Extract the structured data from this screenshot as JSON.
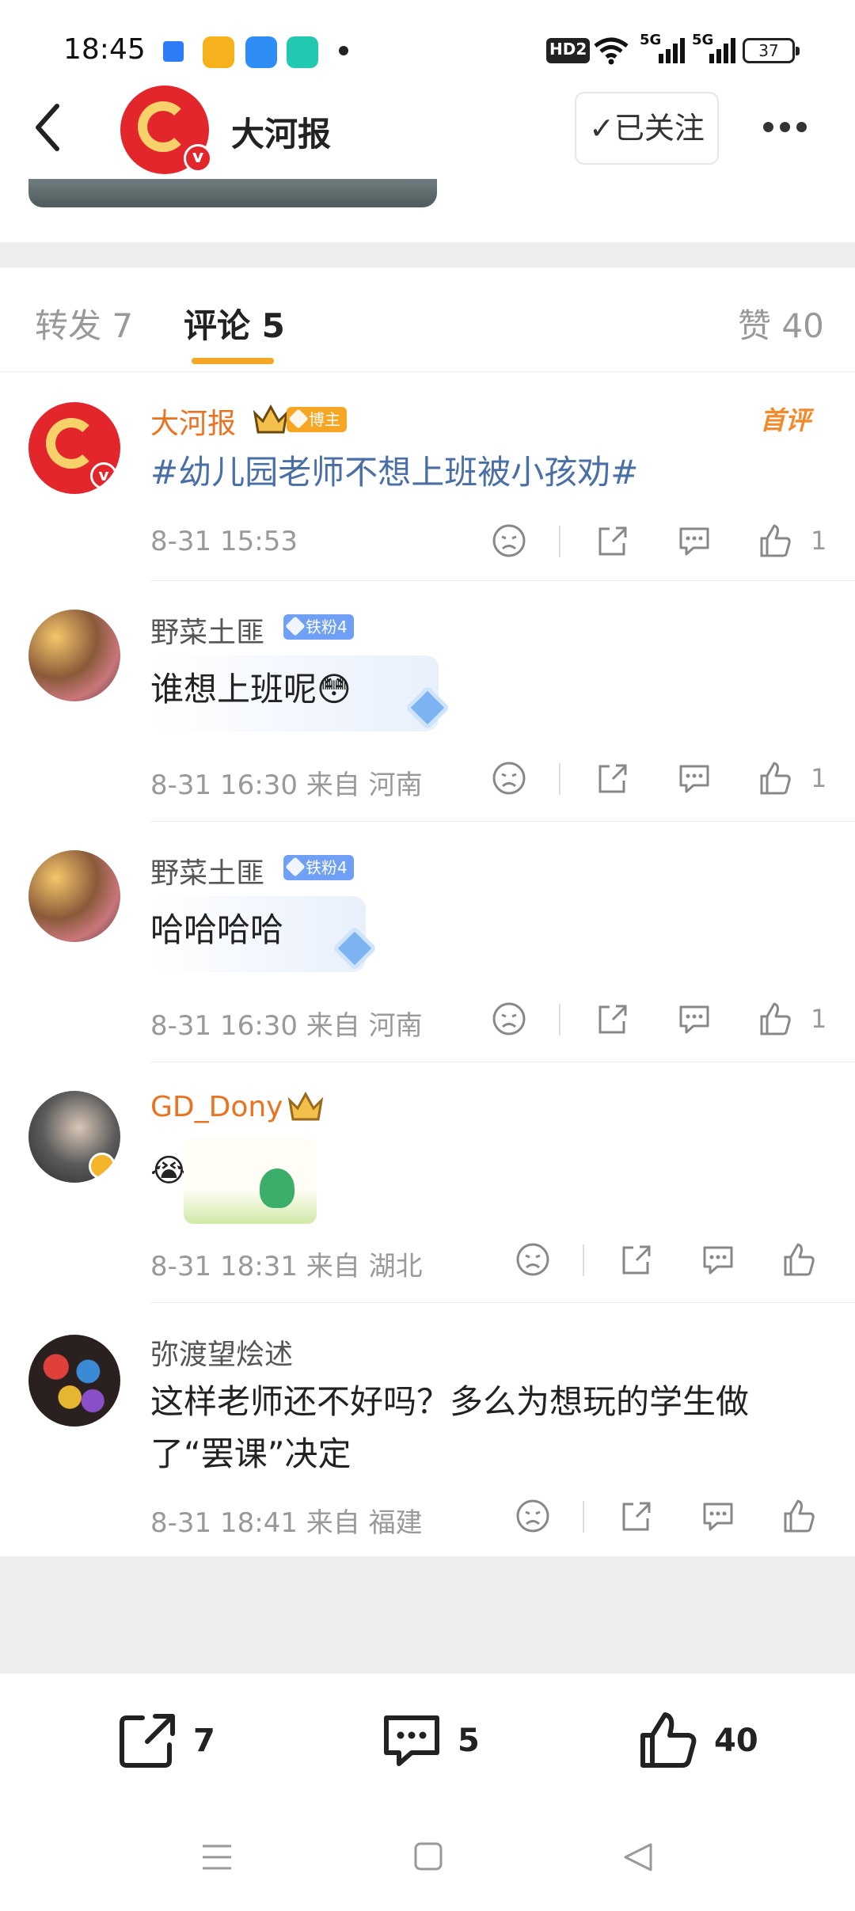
{
  "status_bar": {
    "time": "18:45",
    "network_label": "HD2",
    "signal1": "5G",
    "signal2": "5G",
    "battery": "37"
  },
  "header": {
    "account_name": "大河报",
    "follow_label": "✓已关注"
  },
  "tabs": [
    {
      "label": "转发 7"
    },
    {
      "label": "评论 5"
    },
    {
      "label": "赞 40"
    }
  ],
  "comments": [
    {
      "name": "大河报",
      "badge": "博主",
      "text": "#幼儿园老师不想上班被小孩劝#",
      "meta": "8-31 15:53",
      "likes": "1",
      "tag": "首评"
    },
    {
      "name": "野菜土匪",
      "badge": "铁粉4",
      "text": "谁想上班呢😳",
      "meta": "8-31 16:30  来自 河南",
      "likes": "1"
    },
    {
      "name": "野菜土匪",
      "badge": "铁粉4",
      "text": "哈哈哈哈",
      "meta": "8-31 16:30  来自 河南",
      "likes": "1"
    },
    {
      "name": "GD_Dony",
      "text": "😭",
      "meta": "8-31 18:31  来自 湖北"
    },
    {
      "name": "弥渡望烩述",
      "text_line1": "这样老师还不好吗？多么为想玩的学生做",
      "text_line2": "了“罢课”决定",
      "meta": "8-31 18:41  来自 福建"
    }
  ],
  "bottom_bar": {
    "repost_count": "7",
    "comment_count": "5",
    "like_count": "40"
  },
  "colors": {
    "accent_orange": "#f5a623",
    "name_orange": "#eb7221",
    "topic_blue": "#4a6fa6",
    "brand_red": "#e3262b"
  }
}
